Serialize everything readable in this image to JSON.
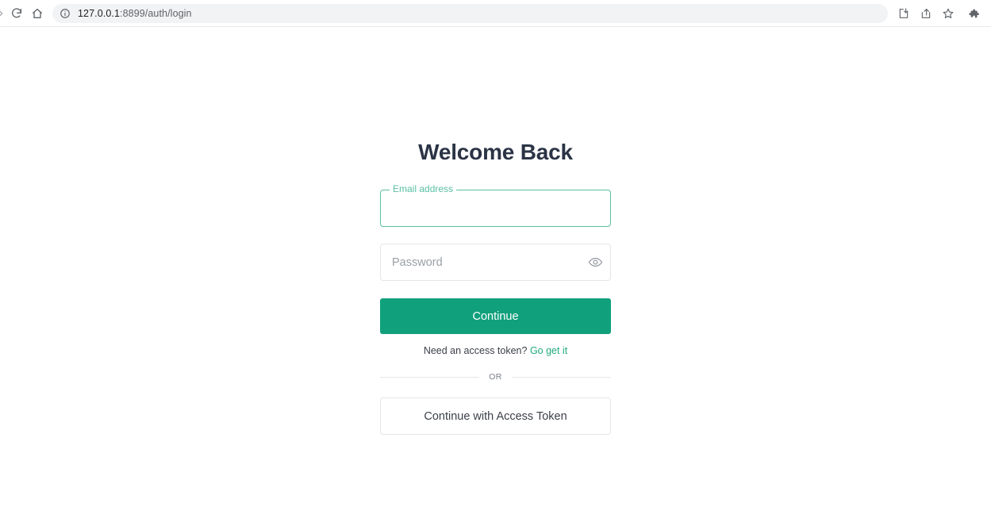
{
  "browser": {
    "nav": {
      "forward_icon": "forward-arrow-icon",
      "reload_icon": "reload-icon",
      "home_icon": "home-icon"
    },
    "omnibox": {
      "info_icon": "info-circle-icon",
      "url_host": "127.0.0.1",
      "url_rest": ":8899/auth/login",
      "full_url": "127.0.0.1:8899/auth/login"
    },
    "actions": [
      {
        "name": "install-app-icon",
        "label": "Install app"
      },
      {
        "name": "share-icon",
        "label": "Share this page"
      },
      {
        "name": "bookmark-star-icon",
        "label": "Bookmark this tab"
      },
      {
        "name": "extensions-puzzle-icon",
        "label": "Extensions"
      }
    ]
  },
  "auth": {
    "title": "Welcome Back",
    "email": {
      "label": "Email address",
      "value": "",
      "placeholder": ""
    },
    "password": {
      "placeholder": "Password",
      "value": "",
      "toggle_icon": "eye-icon"
    },
    "submit_label": "Continue",
    "helper": {
      "text": "Need an access token?",
      "link_label": "Go get it"
    },
    "divider_label": "OR",
    "secondary_label": "Continue with Access Token"
  },
  "colors": {
    "brand_green": "#10a07c",
    "link_green": "#21a97f",
    "focus_border": "#5bc0a4",
    "title": "#2b3445",
    "border": "#e3e5e8"
  }
}
